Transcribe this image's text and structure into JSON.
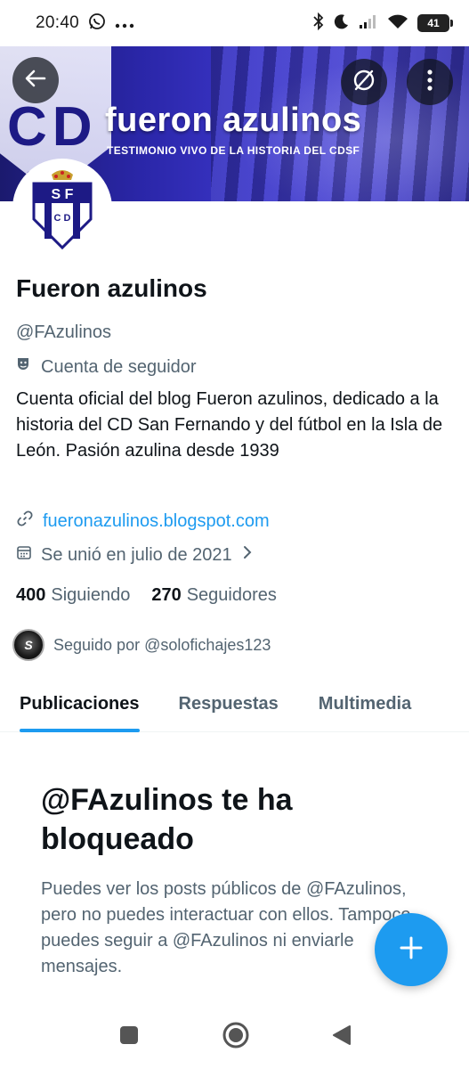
{
  "status_bar": {
    "time": "20:40",
    "battery": "41",
    "icons": [
      "whatsapp-icon",
      "more-dots-icon",
      "bluetooth-icon",
      "do-not-disturb-moon-icon",
      "signal-icon",
      "wifi-icon",
      "battery-icon"
    ]
  },
  "banner": {
    "title": "fueron azulinos",
    "subtitle": "TESTIMONIO VIVO DE LA HISTORIA DEL CDSF",
    "crest_text": "CD",
    "crest_sf": "SF"
  },
  "avatar": {
    "crest_top": "S F",
    "crest_bottom": "C D"
  },
  "profile": {
    "name": "Fueron azulinos",
    "handle": "@FAzulinos",
    "label": "Cuenta de seguidor",
    "bio": "Cuenta oficial del blog Fueron azulinos, dedicado a la historia del CD San Fernando y del fútbol en la Isla de León. Pasión azulina desde 1939",
    "link": "fueronazulinos.blogspot.com",
    "joined": "Se unió en julio de 2021",
    "following_count": "400",
    "following_label": "Siguiendo",
    "followers_count": "270",
    "followers_label": "Seguidores",
    "followed_by": "Seguido por @solofichajes123",
    "followed_by_avatar_text": "S"
  },
  "tabs": [
    {
      "label": "Publicaciones",
      "active": true
    },
    {
      "label": "Respuestas",
      "active": false
    },
    {
      "label": "Multimedia",
      "active": false
    }
  ],
  "blocked": {
    "title": "@FAzulinos te ha bloqueado",
    "text": "Puedes ver los posts públicos de @FAzulinos, pero no puedes interactuar con ellos. Tampoco puedes seguir a @FAzulinos ni enviarle mensajes."
  },
  "colors": {
    "accent": "#1d9bf0",
    "text_primary": "#0f1419",
    "text_secondary": "#536471",
    "banner_blue": "#2a26a8"
  }
}
